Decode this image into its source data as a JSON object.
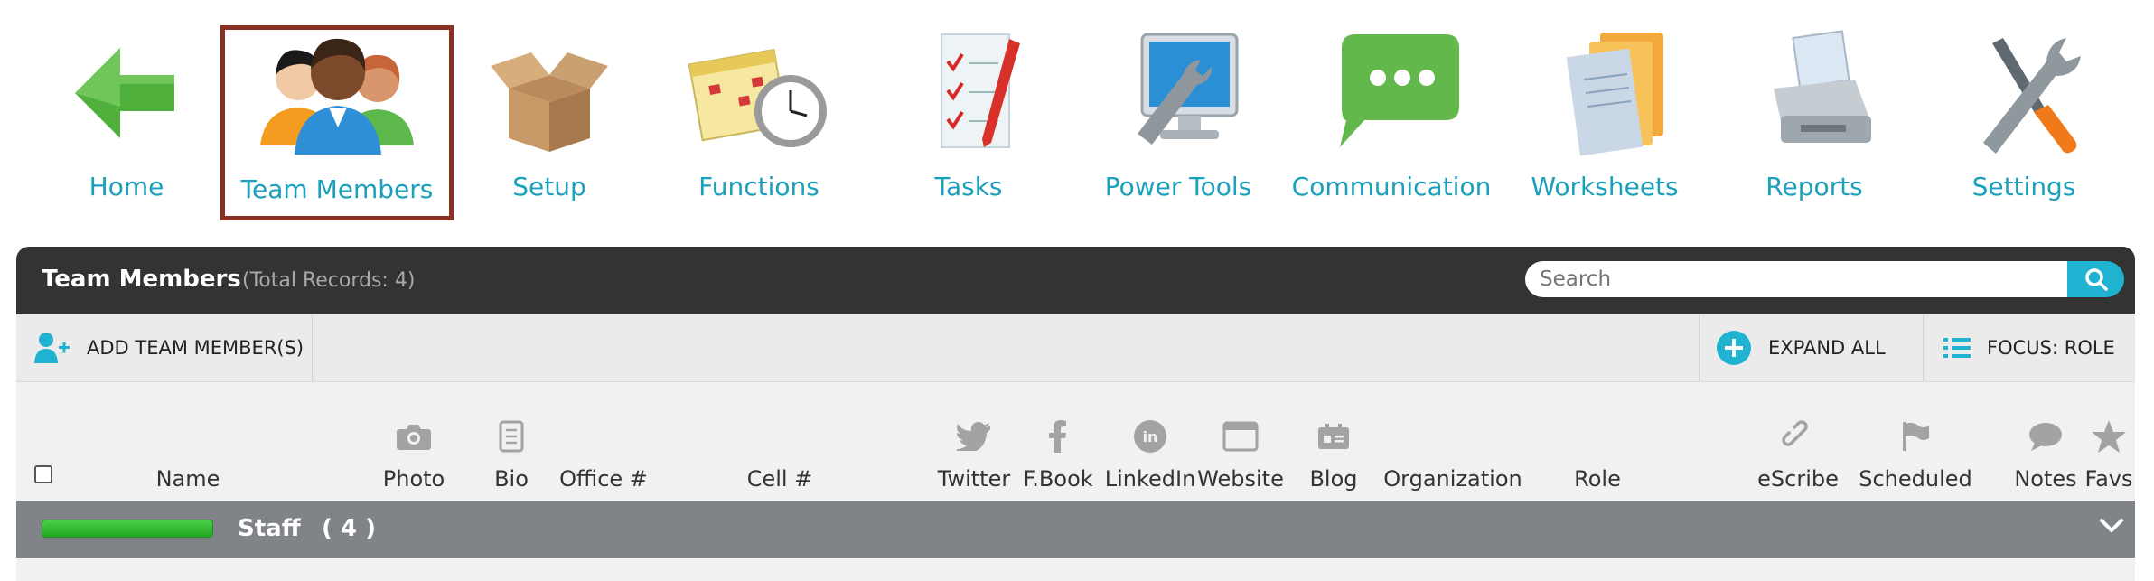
{
  "nav": {
    "home": "Home",
    "team_members": "Team Members",
    "setup": "Setup",
    "functions": "Functions",
    "tasks": "Tasks",
    "power_tools": "Power Tools",
    "communication": "Communication",
    "worksheets": "Worksheets",
    "reports": "Reports",
    "settings": "Settings",
    "active": "team_members"
  },
  "panel": {
    "title": "Team Members",
    "record_count": "(Total Records: 4)",
    "search_placeholder": "Search",
    "search_value": ""
  },
  "toolbar": {
    "add_label": "ADD TEAM MEMBER(S)",
    "expand_label": "EXPAND ALL",
    "focus_label": "FOCUS: ROLE"
  },
  "columns": {
    "name": "Name",
    "photo": "Photo",
    "bio": "Bio",
    "office": "Office #",
    "cell": "Cell #",
    "twitter": "Twitter",
    "facebook": "F.Book",
    "linkedin": "LinkedIn",
    "website": "Website",
    "blog": "Blog",
    "organization": "Organization",
    "role": "Role",
    "escribe": "eScribe",
    "scheduled": "Scheduled",
    "notes": "Notes",
    "favs": "Favs"
  },
  "group": {
    "name": "Staff",
    "count": "( 4 )"
  },
  "colors": {
    "accent": "#1fb3d1",
    "link": "#1a9fbd",
    "header_bg": "#333333",
    "group_bg": "#808488",
    "active_border": "#8a2f23",
    "progress": "#2eb82e"
  },
  "icons": {
    "nav": [
      "home-arrow-icon",
      "team-people-icon",
      "setup-box-icon",
      "functions-calendar-clock-icon",
      "tasks-checklist-icon",
      "power-tools-monitor-wrench-icon",
      "communication-chat-bubble-icon",
      "worksheets-folder-icon",
      "reports-printer-icon",
      "settings-tools-icon"
    ],
    "toolbar": [
      "add-user-icon",
      "plus-circle-icon",
      "list-icon"
    ],
    "columns": [
      "camera-icon",
      "document-icon",
      "twitter-icon",
      "facebook-icon",
      "linkedin-icon",
      "browser-window-icon",
      "id-card-icon",
      "link-icon",
      "flag-icon",
      "speech-bubble-icon",
      "star-icon"
    ]
  }
}
